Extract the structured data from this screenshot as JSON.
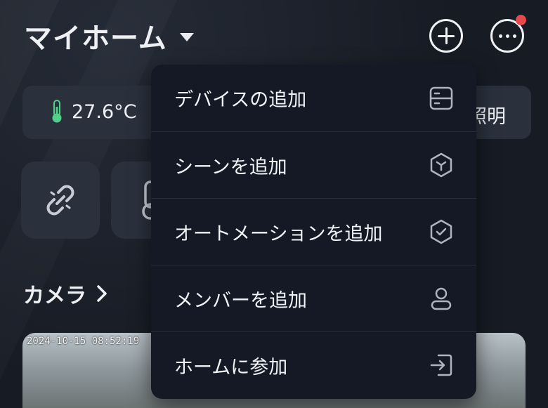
{
  "header": {
    "title": "マイホーム",
    "add_icon": "plus-circle-icon",
    "more_icon": "more-circle-icon",
    "notification_color": "#e5484d"
  },
  "stats": {
    "temperature": "27.6°C",
    "temperature_icon": "thermometer-icon",
    "lighting_label": "照明"
  },
  "tiles": [
    {
      "icon": "unlink-icon"
    },
    {
      "icon": "thermometer-icon"
    }
  ],
  "camera": {
    "label": "カメラ",
    "timestamp": "2024-10-15 08:52:19"
  },
  "menu": {
    "items": [
      {
        "label": "デバイスの追加",
        "icon": "device-icon"
      },
      {
        "label": "シーンを追加",
        "icon": "scene-hexagon-icon"
      },
      {
        "label": "オートメーションを追加",
        "icon": "automation-hexagon-check-icon"
      },
      {
        "label": "メンバーを追加",
        "icon": "member-person-icon"
      },
      {
        "label": "ホームに参加",
        "icon": "join-enter-icon"
      }
    ]
  },
  "colors": {
    "accent_thermometer": "#4fd18b",
    "menu_background": "#141925",
    "card_background": "#2a313d"
  }
}
